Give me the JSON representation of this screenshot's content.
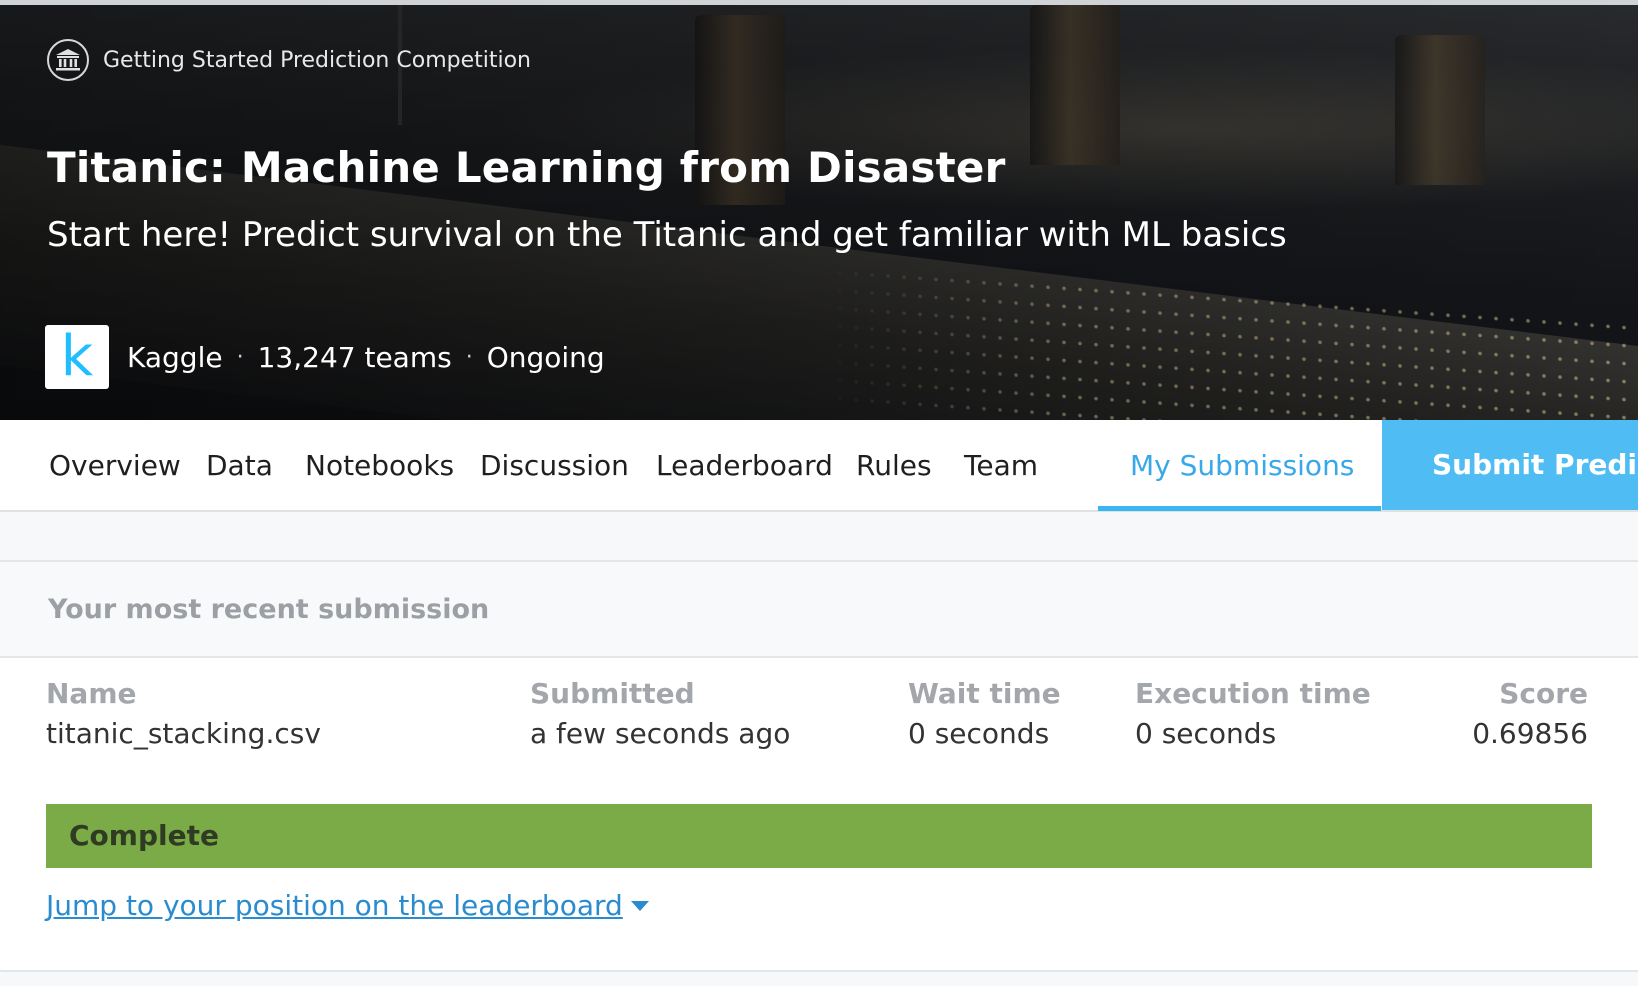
{
  "hero": {
    "competition_type": "Getting Started Prediction Competition",
    "competition_icon": "institution-icon",
    "title": "Titanic: Machine Learning from Disaster",
    "subtitle": "Start here! Predict survival on the Titanic and get familiar with ML basics",
    "host_logo_letter": "k",
    "host": "Kaggle",
    "separator": "·",
    "teams": "13,247 teams",
    "status": "Ongoing"
  },
  "tabs": [
    {
      "label": "Overview"
    },
    {
      "label": "Data"
    },
    {
      "label": "Notebooks"
    },
    {
      "label": "Discussion"
    },
    {
      "label": "Leaderboard"
    },
    {
      "label": "Rules"
    },
    {
      "label": "Team"
    },
    {
      "label": "My Submissions",
      "active": true
    }
  ],
  "submit_button": "Submit Predictions",
  "submission": {
    "header": "Your most recent submission",
    "columns": {
      "name": {
        "label": "Name",
        "value": "titanic_stacking.csv"
      },
      "submitted": {
        "label": "Submitted",
        "value": "a few seconds ago"
      },
      "wait_time": {
        "label": "Wait time",
        "value": "0 seconds"
      },
      "execution_time": {
        "label": "Execution time",
        "value": "0 seconds"
      },
      "score": {
        "label": "Score",
        "value": "0.69856"
      }
    },
    "status": "Complete",
    "status_color": "#7aab46",
    "jump_link": "Jump to your position on the leaderboard"
  },
  "colors": {
    "accent": "#39b5f2",
    "link": "#2a8ccf"
  }
}
